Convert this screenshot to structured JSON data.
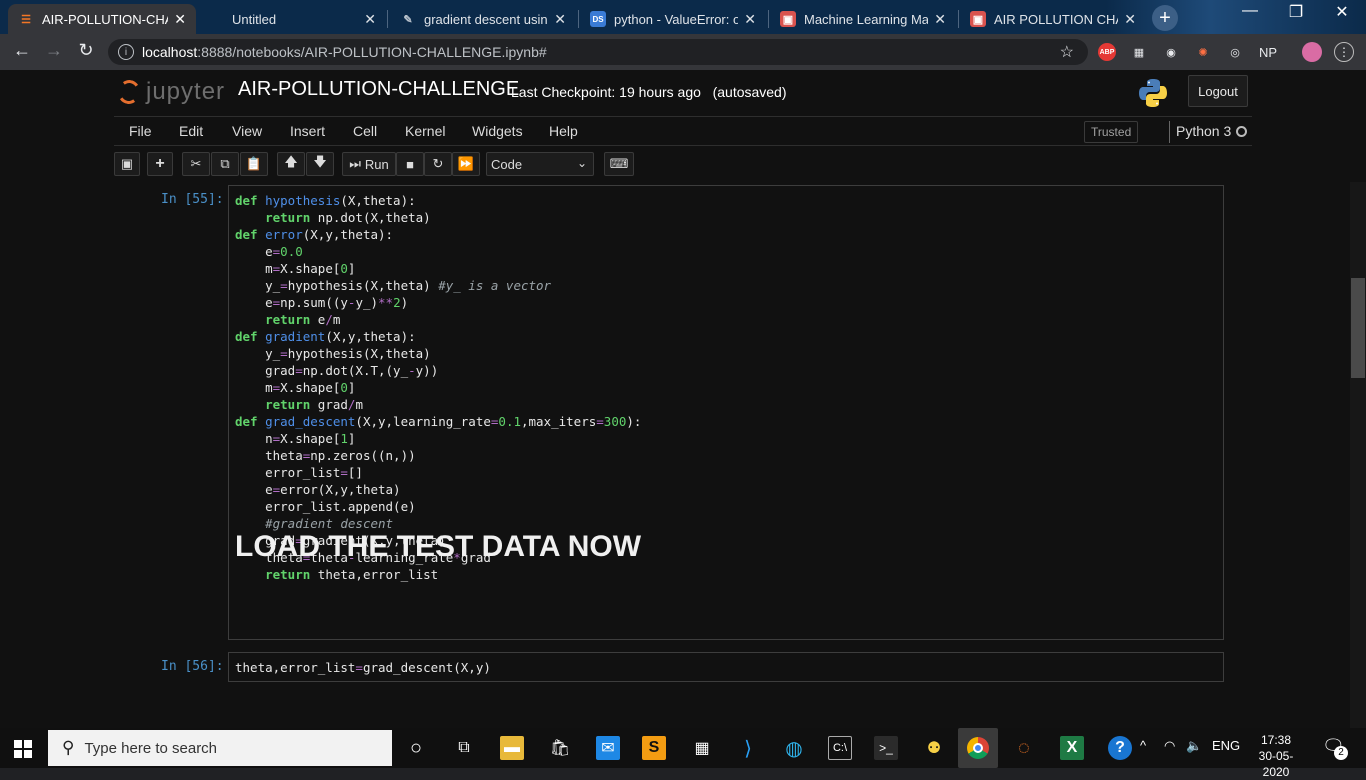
{
  "browser": {
    "tabs": [
      {
        "label": "AIR-POLLUTION-CHALL",
        "icon": "jupyter-favicon",
        "active": true
      },
      {
        "label": "Untitled",
        "icon": "none",
        "active": false
      },
      {
        "label": "gradient descent using",
        "icon": "document-favicon",
        "active": false
      },
      {
        "label": "python - ValueError: op",
        "icon": "ds-favicon",
        "active": false
      },
      {
        "label": "Machine Learning Mast",
        "icon": "box-favicon",
        "active": false
      },
      {
        "label": "AIR POLLUTION CHALL",
        "icon": "box-favicon",
        "active": false
      }
    ],
    "url_host": "localhost",
    "url_rest": ":8888/notebooks/AIR-POLLUTION-CHALLENGE.ipynb#",
    "extensions": [
      "ABP",
      "NP"
    ]
  },
  "jupyter": {
    "logo_text": "jupyter",
    "notebook_title": "AIR-POLLUTION-CHALLENGE",
    "checkpoint": "Last Checkpoint: 19 hours ago",
    "autosave": "(autosaved)",
    "logout_label": "Logout",
    "menu": [
      "File",
      "Edit",
      "View",
      "Insert",
      "Cell",
      "Kernel",
      "Widgets",
      "Help"
    ],
    "trusted_label": "Trusted",
    "kernel_name": "Python 3",
    "toolbar": {
      "run_label": "Run",
      "cell_type": "Code"
    }
  },
  "cells": [
    {
      "prompt": "In [55]:",
      "code": [
        "def hypothesis(X,theta):",
        "    return np.dot(X,theta)",
        "def error(X,y,theta):",
        "    e=0.0",
        "    m=X.shape[0]",
        "    y_=hypothesis(X,theta) #y_ is a vector",
        "    e=np.sum((y-y_)**2)",
        "    return e/m",
        "def gradient(X,y,theta):",
        "    y_=hypothesis(X,theta)",
        "    grad=np.dot(X.T,(y_-y))",
        "    m=X.shape[0]",
        "    return grad/m",
        "def grad_descent(X,y,learning_rate=0.1,max_iters=300):",
        "    n=X.shape[1]",
        "    theta=np.zeros((n,))",
        "    error_list=[]",
        "    e=error(X,y,theta)",
        "    error_list.append(e)",
        "    #gradient descent",
        "    grad=gradient(X,y,theta)",
        "    theta=theta-learning_rate*grad",
        "    return theta,error_list"
      ]
    },
    {
      "prompt": "In [56]:",
      "code": [
        "theta,error_list=grad_descent(X,y)"
      ]
    }
  ],
  "markdown_heading": "LOAD THE TEST DATA NOW",
  "taskbar": {
    "search_placeholder": "Type here to search",
    "language": "ENG",
    "time": "17:38",
    "date": "30-05-2020",
    "notification_count": "2"
  }
}
